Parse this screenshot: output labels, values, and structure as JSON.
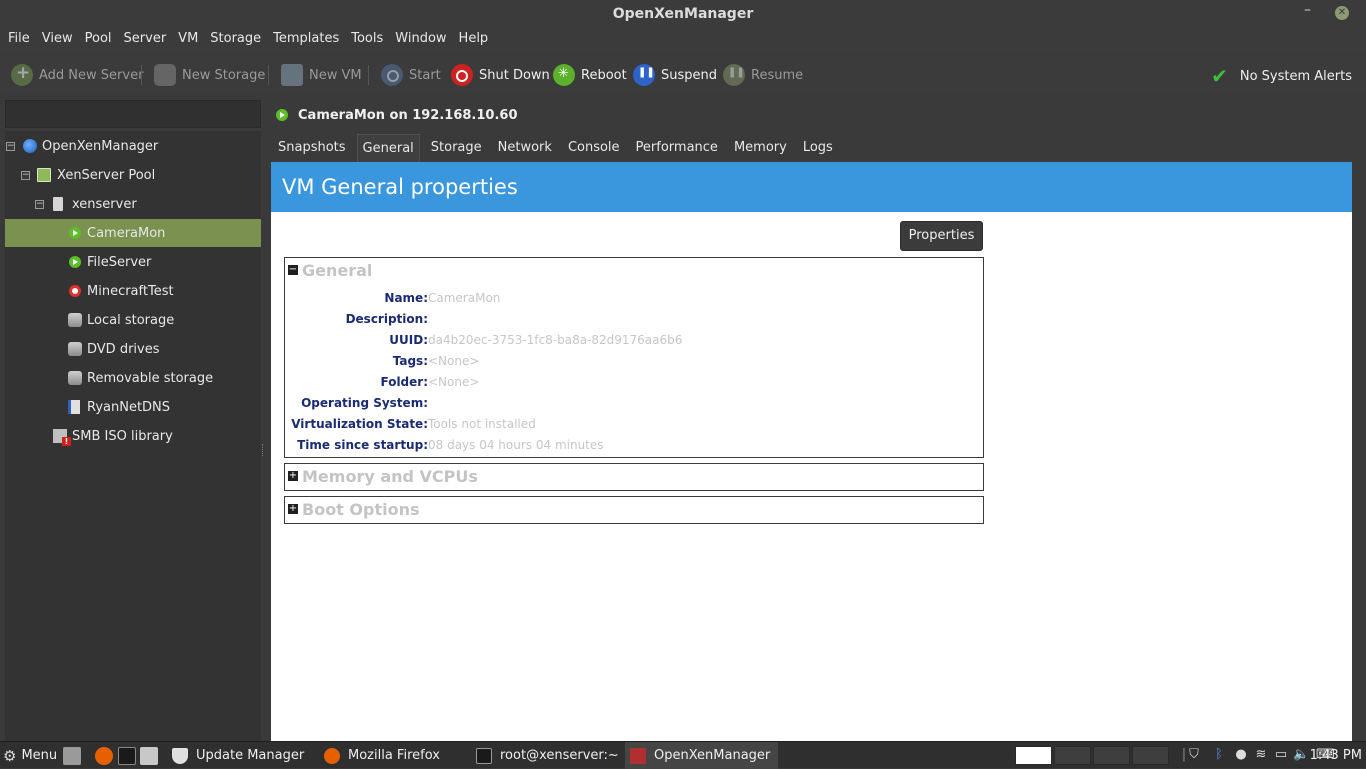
{
  "window": {
    "title": "OpenXenManager",
    "minimize_glyph": "–",
    "close_glyph": "✕"
  },
  "menubar": [
    "File",
    "View",
    "Pool",
    "Server",
    "VM",
    "Storage",
    "Templates",
    "Tools",
    "Window",
    "Help"
  ],
  "toolbar": {
    "add_new_server": "Add New Server",
    "new_storage": "New Storage",
    "new_vm": "New VM",
    "start": "Start",
    "shut_down": "Shut Down",
    "reboot": "Reboot",
    "suspend": "Suspend",
    "resume": "Resume",
    "alerts": "No System Alerts",
    "alerts_icon": "check-icon"
  },
  "search": {
    "value": ""
  },
  "tree": {
    "root": "OpenXenManager",
    "pool": "XenServer Pool",
    "server": "xenserver",
    "vms": [
      "CameraMon",
      "FileServer",
      "MinecraftTest"
    ],
    "storages": [
      "Local storage",
      "DVD drives",
      "Removable storage"
    ],
    "network": "RyanNetDNS",
    "iso": "SMB ISO library",
    "expander_open": "−"
  },
  "vm_header": "CameraMon on 192.168.10.60",
  "tabs": [
    "Snapshots",
    "General",
    "Storage",
    "Network",
    "Console",
    "Performance",
    "Memory",
    "Logs"
  ],
  "active_tab": "General",
  "page_title": "VM General properties",
  "properties_button": "Properties",
  "sections": {
    "general": {
      "title": "General",
      "toggle": "−",
      "rows": [
        {
          "label": "Name:",
          "value": "CameraMon"
        },
        {
          "label": "Description:",
          "value": ""
        },
        {
          "label": "UUID:",
          "value": "da4b20ec-3753-1fc8-ba8a-82d9176aa6b6"
        },
        {
          "label": "Tags:",
          "value": "<None>"
        },
        {
          "label": "Folder:",
          "value": "<None>"
        },
        {
          "label": "Operating System:",
          "value": ""
        },
        {
          "label": "Virtualization State:",
          "value": "Tools not installed"
        },
        {
          "label": "Time since startup:",
          "value": "08 days 04 hours 04 minutes"
        }
      ]
    },
    "memory": {
      "title": "Memory and VCPUs",
      "toggle": "+"
    },
    "boot": {
      "title": "Boot Options",
      "toggle": "+"
    }
  },
  "taskbar": {
    "menu": "Menu",
    "menu_icon": "⚙",
    "tasks": [
      "Update Manager",
      "Mozilla Firefox",
      "root@xenserver:~",
      "OpenXenManager"
    ],
    "clock": "1:43 PM",
    "colors": {
      "firefox": "#e66000",
      "terminal": "#1a1a1a",
      "openxen": "#b03030",
      "shield": "#e0e0e0"
    }
  }
}
